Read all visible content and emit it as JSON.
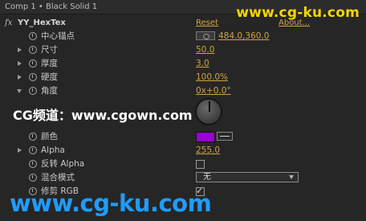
{
  "breadcrumb": "Comp 1 • Black Solid 1",
  "watermark_top": "www.cg-ku.com",
  "watermark_bottom": "www.cg-ku.com",
  "overlay_text": "CG频道：www.cgown.com",
  "effect": {
    "fx_symbol": "fx",
    "name": "YY_HexTex",
    "reset_label": "Reset",
    "about_label": "About..."
  },
  "properties": [
    {
      "label": "中心锚点",
      "value": "484.0,360.0"
    },
    {
      "label": "尺寸",
      "value": "50.0"
    },
    {
      "label": "厚度",
      "value": "3.0"
    },
    {
      "label": "硬度",
      "value": "100.0%"
    },
    {
      "label": "角度",
      "value": "0x+0.0°"
    },
    {
      "label": "颜色",
      "value": ""
    },
    {
      "label": "Alpha",
      "value": "255.0"
    },
    {
      "label": "反转 Alpha",
      "value": ""
    },
    {
      "label": "混合模式",
      "value": "无"
    },
    {
      "label": "修剪 RGB",
      "value": ""
    }
  ],
  "colors": {
    "accent_value": "#d2a342",
    "color_swatch": "#9b00d6",
    "watermark_yellow": "#f6d500",
    "watermark_blue": "#1f9cff"
  },
  "state": {
    "invert_alpha_checked": false,
    "clip_rgb_checked": true
  }
}
